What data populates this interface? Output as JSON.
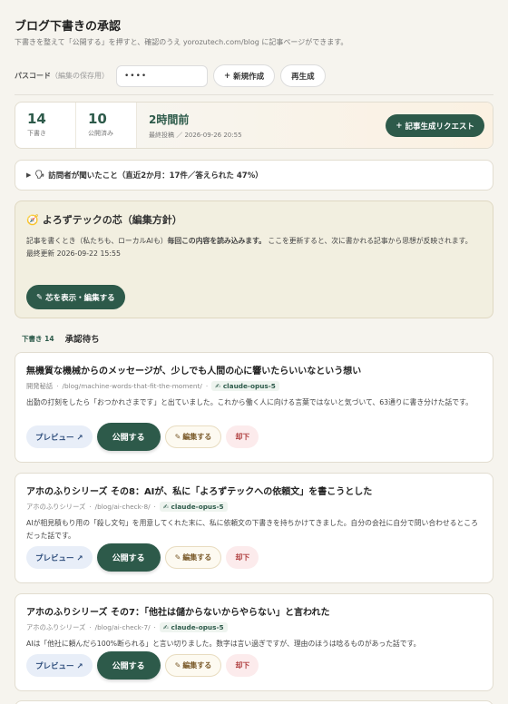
{
  "header": {
    "title": "ブログ下書きの承認",
    "subtitle": "下書きを整えて「公開する」を押すと、確認のうえ yorozutech.com/blog に記事ページができます。"
  },
  "passcode": {
    "label": "パスコード",
    "sub": "（編集の保存用）",
    "value": "••••",
    "new_label": "新規作成",
    "regen_label": "再生成"
  },
  "stats": {
    "drafts": {
      "value": "14",
      "label": "下書き"
    },
    "published": {
      "value": "10",
      "label": "公開済み"
    },
    "last": {
      "value": "2時間前",
      "label": "最終投稿 ／ 2026-09-26 20:55"
    },
    "request_label": "記事生成リクエスト"
  },
  "visitors": {
    "text": "訪問者が聞いたこと（直近2か月：17件／答えられた 47%）"
  },
  "core": {
    "title": "よろずテックの芯（編集方針）",
    "body_prefix": "記事を書くとき（私たちも、ローカルAIも）",
    "body_bold": "毎回この内容を読み込みます。",
    "body_suffix": " ここを更新すると、次に書かれる記事から思想が反映されます。",
    "updated": "最終更新 2026-09-22 15:55",
    "button_label": "芯を表示・編集する"
  },
  "section": {
    "tag": "下書き 14",
    "title": "承認待ち"
  },
  "buttons": {
    "preview": "プレビュー ↗",
    "publish": "公開する",
    "edit": "編集する",
    "reject": "却下"
  },
  "drafts": [
    {
      "title": "無機質な機械からのメッセージが、少しでも人間の心に響いたらいいなという想い",
      "category": "開発秘話",
      "path": "/blog/machine-words-that-fit-the-moment/",
      "model": "claude-opus-5",
      "desc": "出勤の打刻をしたら「おつかれさまです」と出ていました。これから働く人に向ける言葉ではないと気づいて、63通りに書き分けた話です。"
    },
    {
      "title": "アホのふりシリーズ その8：AIが、私に「よろずテックへの依頼文」を書こうとした",
      "category": "アホのふりシリーズ",
      "path": "/blog/ai-check-8/",
      "model": "claude-opus-5",
      "desc": "AIが相見積もり用の「殺し文句」を用意してくれた末に、私に依頼文の下書きを持ちかけてきました。自分の会社に自分で問い合わせるところだった話です。"
    },
    {
      "title": "アホのふりシリーズ その7：「他社は儲からないからやらない」と言われた",
      "category": "アホのふりシリーズ",
      "path": "/blog/ai-check-7/",
      "model": "claude-opus-5",
      "desc": "AIは「他社に頼んだら100%断られる」と言い切りました。数字は言い過ぎですが、理由のほうは唸るものがあった話です。"
    }
  ]
}
